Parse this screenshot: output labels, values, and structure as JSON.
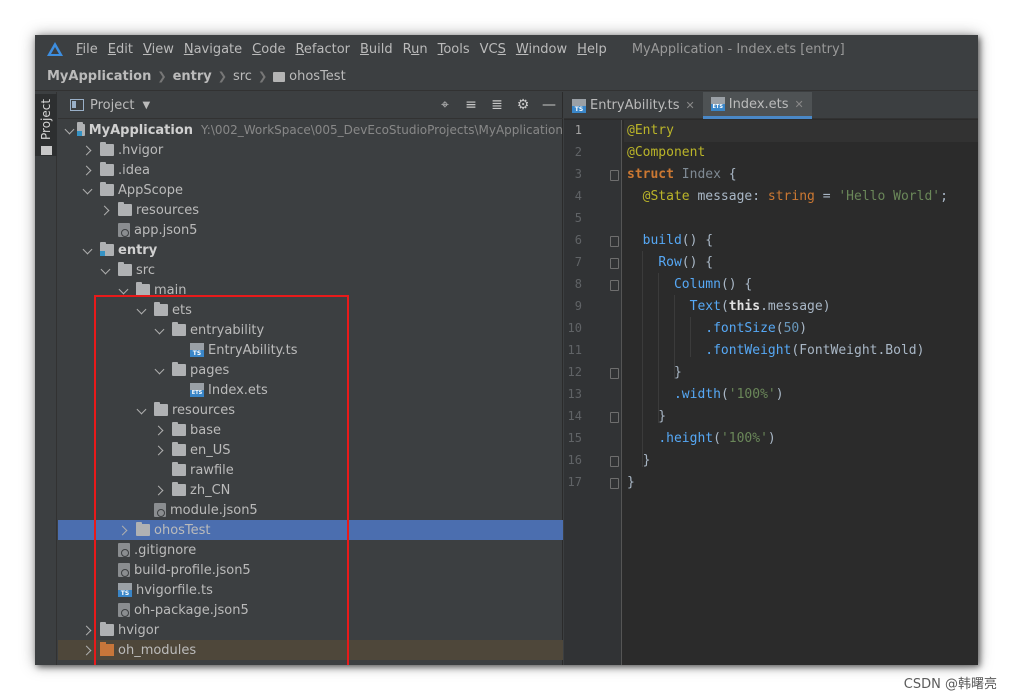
{
  "menubar": {
    "items": [
      {
        "label": "File",
        "u": "F"
      },
      {
        "label": "Edit",
        "u": "E"
      },
      {
        "label": "View",
        "u": "V"
      },
      {
        "label": "Navigate",
        "u": "N"
      },
      {
        "label": "Code",
        "u": "C"
      },
      {
        "label": "Refactor",
        "u": "R"
      },
      {
        "label": "Build",
        "u": "B"
      },
      {
        "label": "Run",
        "u": "u"
      },
      {
        "label": "Tools",
        "u": "T"
      },
      {
        "label": "VCS",
        "u": "S"
      },
      {
        "label": "Window",
        "u": "W"
      },
      {
        "label": "Help",
        "u": "H"
      }
    ],
    "window_title": "MyApplication - Index.ets [entry]"
  },
  "breadcrumb": {
    "items": [
      "MyApplication",
      "entry",
      "src",
      "ohosTest"
    ]
  },
  "toolstrip": {
    "project_tab": "Project"
  },
  "project_panel": {
    "title": "Project",
    "tools": [
      "crosshair-icon",
      "collapse-all-icon",
      "expand-all-icon",
      "gear-icon",
      "minimize-icon"
    ],
    "tree": [
      {
        "label": "MyApplication",
        "path": "Y:\\002_WorkSpace\\005_DevEcoStudioProjects\\MyApplication",
        "depth": 0,
        "arrow": "down",
        "icon": "folder-module",
        "bold": true
      },
      {
        "label": ".hvigor",
        "depth": 1,
        "arrow": "right",
        "icon": "folder"
      },
      {
        "label": ".idea",
        "depth": 1,
        "arrow": "right",
        "icon": "folder"
      },
      {
        "label": "AppScope",
        "depth": 1,
        "arrow": "down",
        "icon": "folder"
      },
      {
        "label": "resources",
        "depth": 2,
        "arrow": "right",
        "icon": "folder"
      },
      {
        "label": "app.json5",
        "depth": 2,
        "arrow": "none",
        "icon": "file-json"
      },
      {
        "label": "entry",
        "depth": 1,
        "arrow": "down",
        "icon": "folder-module",
        "bold": true
      },
      {
        "label": "src",
        "depth": 2,
        "arrow": "down",
        "icon": "folder"
      },
      {
        "label": "main",
        "depth": 3,
        "arrow": "down",
        "icon": "folder"
      },
      {
        "label": "ets",
        "depth": 4,
        "arrow": "down",
        "icon": "folder"
      },
      {
        "label": "entryability",
        "depth": 5,
        "arrow": "down",
        "icon": "folder"
      },
      {
        "label": "EntryAbility.ts",
        "depth": 6,
        "arrow": "none",
        "icon": "file-ts"
      },
      {
        "label": "pages",
        "depth": 5,
        "arrow": "down",
        "icon": "folder"
      },
      {
        "label": "Index.ets",
        "depth": 6,
        "arrow": "none",
        "icon": "file-ets"
      },
      {
        "label": "resources",
        "depth": 4,
        "arrow": "down",
        "icon": "folder"
      },
      {
        "label": "base",
        "depth": 5,
        "arrow": "right",
        "icon": "folder"
      },
      {
        "label": "en_US",
        "depth": 5,
        "arrow": "right",
        "icon": "folder"
      },
      {
        "label": "rawfile",
        "depth": 5,
        "arrow": "none",
        "icon": "folder"
      },
      {
        "label": "zh_CN",
        "depth": 5,
        "arrow": "right",
        "icon": "folder"
      },
      {
        "label": "module.json5",
        "depth": 4,
        "arrow": "none",
        "icon": "file-json"
      },
      {
        "label": "ohosTest",
        "depth": 3,
        "arrow": "right",
        "icon": "folder",
        "selected": true
      },
      {
        "label": ".gitignore",
        "depth": 2,
        "arrow": "none",
        "icon": "file-json"
      },
      {
        "label": "build-profile.json5",
        "depth": 2,
        "arrow": "none",
        "icon": "file-json"
      },
      {
        "label": "hvigorfile.ts",
        "depth": 2,
        "arrow": "none",
        "icon": "file-ts"
      },
      {
        "label": "oh-package.json5",
        "depth": 2,
        "arrow": "none",
        "icon": "file-json"
      },
      {
        "label": "hvigor",
        "depth": 1,
        "arrow": "right",
        "icon": "folder"
      },
      {
        "label": "oh_modules",
        "depth": 1,
        "arrow": "right",
        "icon": "folder-orange",
        "excluded": true
      }
    ]
  },
  "editor": {
    "tabs": [
      {
        "label": "EntryAbility.ts",
        "icon": "file-ts",
        "active": false
      },
      {
        "label": "Index.ets",
        "icon": "file-ets",
        "active": true
      }
    ],
    "current_line": 1,
    "lines": [
      [
        [
          "ann",
          "@Entry"
        ]
      ],
      [
        [
          "ann",
          "@Component"
        ]
      ],
      [
        [
          "kwb",
          "struct "
        ],
        [
          "dim",
          "Index "
        ],
        [
          "",
          "{"
        ]
      ],
      [
        [
          "",
          "  "
        ],
        [
          "ann",
          "@State "
        ],
        [
          "",
          "message: "
        ],
        [
          "kw",
          "string "
        ],
        [
          "",
          "= "
        ],
        [
          "str",
          "'Hello World'"
        ],
        [
          "",
          ";"
        ]
      ],
      [],
      [
        [
          "",
          "  "
        ],
        [
          "fn",
          "build"
        ],
        [
          "",
          "() {"
        ]
      ],
      [
        [
          "",
          "    "
        ],
        [
          "fn",
          "Row"
        ],
        [
          "",
          "() {"
        ]
      ],
      [
        [
          "",
          "      "
        ],
        [
          "fn",
          "Column"
        ],
        [
          "",
          "() {"
        ]
      ],
      [
        [
          "",
          "        "
        ],
        [
          "fn",
          "Text"
        ],
        [
          "",
          "("
        ],
        [
          "bold-white",
          "this"
        ],
        [
          "",
          ".message)"
        ]
      ],
      [
        [
          "",
          "          "
        ],
        [
          "fn",
          ".fontSize"
        ],
        [
          "",
          "("
        ],
        [
          "num",
          "50"
        ],
        [
          "",
          ")"
        ]
      ],
      [
        [
          "",
          "          "
        ],
        [
          "fn",
          ".fontWeight"
        ],
        [
          "",
          "(FontWeight.Bold)"
        ]
      ],
      [
        [
          "",
          "      }"
        ]
      ],
      [
        [
          "",
          "      "
        ],
        [
          "fn",
          ".width"
        ],
        [
          "",
          "("
        ],
        [
          "str",
          "'100%'"
        ],
        [
          "",
          ")"
        ]
      ],
      [
        [
          "",
          "    }"
        ]
      ],
      [
        [
          "",
          "    "
        ],
        [
          "fn",
          ".height"
        ],
        [
          "",
          "("
        ],
        [
          "str",
          "'100%'"
        ],
        [
          "",
          ")"
        ]
      ],
      [
        [
          "",
          "  }"
        ]
      ],
      [
        [
          "",
          "}"
        ]
      ]
    ],
    "fold_lines": [
      3,
      6,
      7,
      8,
      12,
      14,
      16,
      17
    ]
  },
  "watermark": "CSDN @韩曙亮"
}
